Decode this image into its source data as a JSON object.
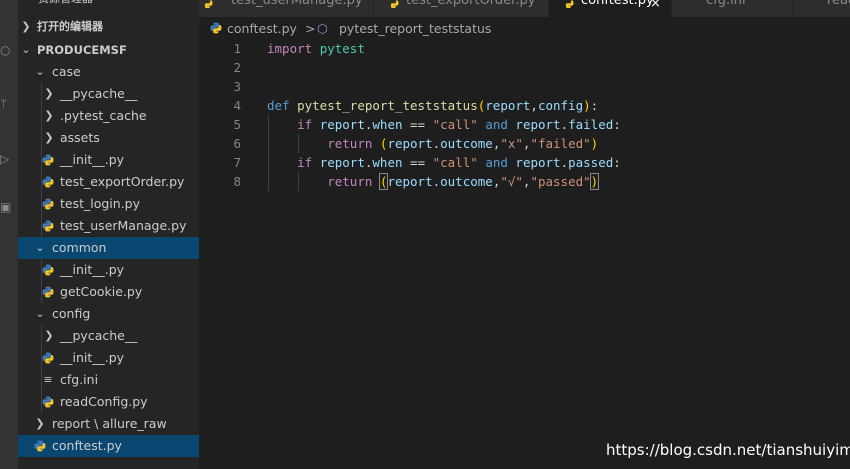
{
  "sidebar": {
    "header_label": "资源管理器",
    "open_editors_label": "打开的编辑器",
    "project_label": "PRODUCEMSF",
    "items": [
      {
        "label": "case",
        "kind": "folder-open"
      },
      {
        "label": "__pycache__",
        "kind": "folder"
      },
      {
        "label": ".pytest_cache",
        "kind": "folder"
      },
      {
        "label": "assets",
        "kind": "folder"
      },
      {
        "label": "__init__.py",
        "kind": "py"
      },
      {
        "label": "test_exportOrder.py",
        "kind": "py"
      },
      {
        "label": "test_login.py",
        "kind": "py"
      },
      {
        "label": "test_userManage.py",
        "kind": "py"
      },
      {
        "label": "common",
        "kind": "folder-open",
        "selected": true
      },
      {
        "label": "__init__.py",
        "kind": "py"
      },
      {
        "label": "getCookie.py",
        "kind": "py"
      },
      {
        "label": "config",
        "kind": "folder-open"
      },
      {
        "label": "__pycache__",
        "kind": "folder"
      },
      {
        "label": "__init__.py",
        "kind": "py"
      },
      {
        "label": "cfg.ini",
        "kind": "ini"
      },
      {
        "label": "readConfig.py",
        "kind": "py"
      },
      {
        "label": "report \\ allure_raw",
        "kind": "folder"
      },
      {
        "label": "conftest.py",
        "kind": "py",
        "selected": true
      }
    ]
  },
  "tabs": [
    {
      "label": "test_userManage.py"
    },
    {
      "label": "test_exportOrder.py"
    },
    {
      "label": "conftest.py",
      "active": true,
      "close": "×"
    },
    {
      "label": "cfg.ini"
    },
    {
      "label": "read"
    }
  ],
  "breadcrumb": {
    "file": "conftest.py",
    "separator": ">",
    "symbol": "pytest_report_teststatus"
  },
  "editor": {
    "line_numbers": [
      "1",
      "2",
      "3",
      "4",
      "5",
      "6",
      "7",
      "8"
    ],
    "lines": {
      "l1": {
        "kw": "import",
        "mod": "pytest"
      },
      "l4": {
        "kw": "def",
        "fn": "pytest_report_teststatus",
        "p1": "report",
        "p2": "config"
      },
      "l5": {
        "ctl": "if",
        "obj": "report",
        "attr": "when",
        "op": "==",
        "str": "\"call\"",
        "and": "and",
        "obj2": "report",
        "attr2": "failed"
      },
      "l6": {
        "ctl": "return",
        "obj": "report",
        "attr": "outcome",
        "s1": "\"x\"",
        "s2": "\"failed\""
      },
      "l7": {
        "ctl": "if",
        "obj": "report",
        "attr": "when",
        "op": "==",
        "str": "\"call\"",
        "and": "and",
        "obj2": "report",
        "attr2": "passed"
      },
      "l8": {
        "ctl": "return",
        "obj": "report",
        "attr": "outcome",
        "s1": "\"√\"",
        "s2": "\"passed\""
      }
    }
  },
  "watermark": "https://blog.csdn.net/tianshuiyimo",
  "colors": {
    "selection": "#094771",
    "keyword": "#569cd6",
    "string": "#ce9178",
    "function": "#dcdcaa"
  }
}
